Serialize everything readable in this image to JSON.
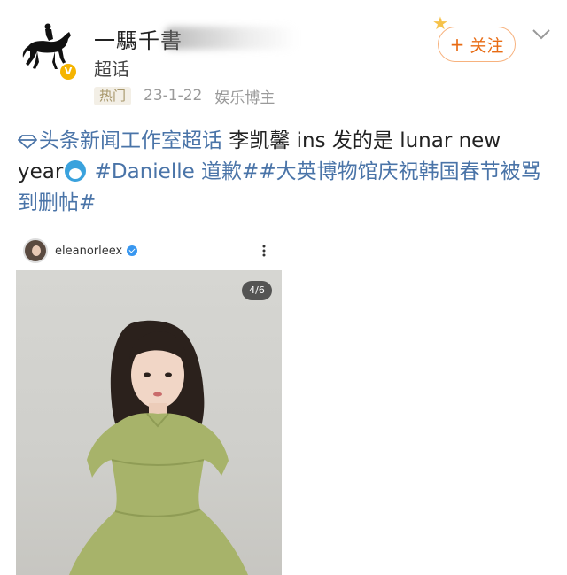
{
  "author": {
    "name": "一騳千書",
    "verified_badge": "V"
  },
  "supertopic_label": "超话",
  "meta": {
    "hot_badge": "热门",
    "date": "23-1-22",
    "tag": "娱乐博主"
  },
  "follow_button": {
    "label": "关注",
    "plus": "+"
  },
  "post": {
    "topic_link": "头条新闻工作室超话",
    "text1": " 李凯馨 ins 发的是 lunar new year",
    "hashtag1": "#Danielle 道歉#",
    "hashtag2": "#大英博物馆庆祝韩国春节被骂到删帖#"
  },
  "instagram": {
    "username": "eleanorleex",
    "photo_counter": "4/6"
  },
  "colors": {
    "link": "#4a74a8",
    "follow_orange": "#e86b13",
    "verified_gold": "#f5b400"
  }
}
